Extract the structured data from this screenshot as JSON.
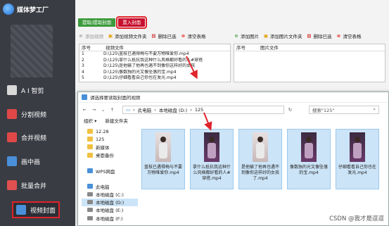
{
  "app": {
    "title": "媒体梦工厂"
  },
  "sidebar": {
    "items": [
      {
        "label": "A I 智剪"
      },
      {
        "label": "分割视频"
      },
      {
        "label": "合并视频"
      },
      {
        "label": "画中画"
      },
      {
        "label": "批量合并"
      },
      {
        "label": "视频封面"
      }
    ]
  },
  "tabs": {
    "extract": "提取/提取封面",
    "import": "置入封面"
  },
  "toolbar_left": {
    "add_video": "添加视频",
    "add_video_folder": "添加视频文件夹",
    "delete_selected": "删除已选",
    "clear_table": "清空表格"
  },
  "toolbar_right": {
    "add_image": "添加图片",
    "add_image_folder": "添加图片文件夹",
    "delete_selected": "删除已选",
    "clear_table": "清空表格"
  },
  "video_table": {
    "headers": [
      "序号",
      "视频文件"
    ],
    "rows": [
      {
        "num": "1",
        "file": "D:\\125\\蓝枝已遇得梅与不要万物唯爱你.mp4"
      },
      {
        "num": "2",
        "file": "D:\\125\\拿什么抵抗我这种什么风格都好看的人#穿搭"
      },
      {
        "num": "3",
        "file": "D:\\125\\是他输了他再也遇不到像你这样好的女孩"
      },
      {
        "num": "4",
        "file": "D:\\125\\像数独的光又像坠落的宝.mp4"
      },
      {
        "num": "5",
        "file": "D:\\125\\仔细看看自己你也在发光.mp4"
      }
    ]
  },
  "image_table": {
    "headers": [
      "序号",
      "图片文件"
    ]
  },
  "dialog": {
    "title": "请选择要读取封面的视频",
    "breadcrumb": [
      "此电脑",
      "本地磁盘 (D:)",
      "125"
    ],
    "search_placeholder": "搜索\"125\"",
    "organize": "组织 ▾",
    "new_folder": "新建文件夹",
    "nav_items": [
      {
        "label": "12.28",
        "kind": "folder"
      },
      {
        "label": "125",
        "kind": "folder"
      },
      {
        "label": "新媒体",
        "kind": "folder"
      },
      {
        "label": "桌面备份",
        "kind": "folder"
      },
      {
        "label": "",
        "kind": "blank"
      },
      {
        "label": "WPS网盘",
        "kind": "cloud"
      },
      {
        "label": "",
        "kind": "blank"
      },
      {
        "label": "此电脑",
        "kind": "pc"
      },
      {
        "label": "本地磁盘 (C:)",
        "kind": "drive"
      },
      {
        "label": "本地磁盘 (D:)",
        "kind": "drive",
        "selected": true
      },
      {
        "label": "本地磁盘 (E:)",
        "kind": "drive"
      },
      {
        "label": "本地磁盘 (F:)",
        "kind": "drive"
      }
    ],
    "files": [
      {
        "name": "蓝枝已遇得梅与不要万物唯爱你.mp4",
        "thumb": "light"
      },
      {
        "name": "拿什么抵抗我这种什么风格都好看的人#穿搭.mp4",
        "thumb": "dark"
      },
      {
        "name": "是他输了他再也遇不到像你这样好的女孩了.mp4",
        "thumb": "light"
      },
      {
        "name": "像数独的光又像坠落的宝.mp4",
        "thumb": "dark"
      },
      {
        "name": "仔细看看自己你也在发光.mp4",
        "thumb": "dark"
      }
    ]
  },
  "watermark": "CSDN @我才是逗逗",
  "colors": {
    "sidebar_bg": "#3a3c44",
    "tab_green": "#3d9b3d",
    "tab_red": "#c8102e",
    "highlight_red": "#e0232b",
    "selected_blue": "#cce4f7"
  }
}
